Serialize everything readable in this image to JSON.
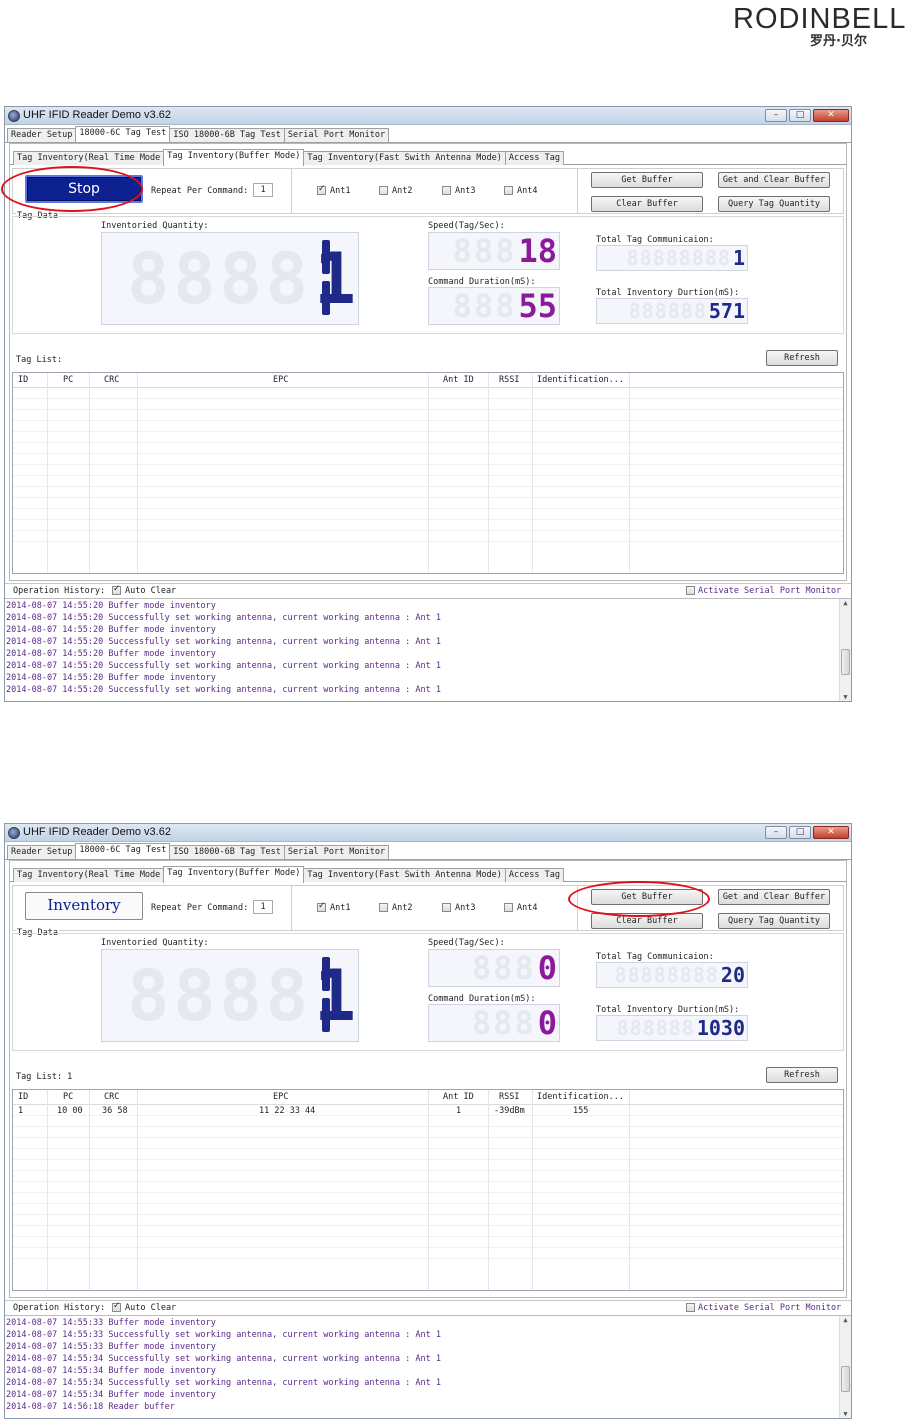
{
  "logo": {
    "main": "RODINBELL",
    "sub": "罗丹·贝尔"
  },
  "common": {
    "window_title": "UHF IFID Reader Demo v3.62",
    "window_buttons": {
      "minimize": "–",
      "maximize": "□",
      "close": "✕"
    },
    "main_tabs": [
      "Reader Setup",
      "18000-6C Tag Test",
      "ISO 18000-6B Tag Test",
      "Serial Port Monitor"
    ],
    "sub_tabs": [
      "Tag Inventory(Real Time Mode",
      "Tag Inventory(Buffer Mode)",
      "Tag Inventory(Fast Swith Antenna Mode)",
      "Access Tag"
    ],
    "repeat_label": "Repeat Per Command:",
    "repeat_value": "1",
    "antennas": [
      "Ant1",
      "Ant2",
      "Ant3",
      "Ant4"
    ],
    "buttons": {
      "get_buffer": "Get Buffer",
      "get_clear_buffer": "Get and Clear Buffer",
      "clear_buffer": "Clear Buffer",
      "query_tag_quantity": "Query Tag Quantity",
      "refresh": "Refresh"
    },
    "tag_data_label": "Tag Data",
    "inventoried_quantity_label": "Inventoried Quantity:",
    "speed_label": "Speed(Tag/Sec):",
    "command_duration_label": "Command Duration(mS):",
    "total_comm_label": "Total Tag Communicaion:",
    "total_duration_label": "Total Inventory Durtion(mS):",
    "columns": [
      "ID",
      "PC",
      "CRC",
      "EPC",
      "Ant ID",
      "RSSI",
      "Identification..."
    ],
    "operation_history_label": "Operation History:",
    "auto_clear_label": "Auto Clear",
    "serial_monitor_label": "Activate Serial Port Monitor"
  },
  "screens": [
    {
      "action_button": "Stop",
      "tag_list_label": "Tag List:",
      "inventoried_quantity": "1",
      "speed": "18",
      "command_duration": "55",
      "total_tag_communication": "1",
      "total_inventory_duration": "571",
      "rows": [],
      "log": [
        "2014-08-07 14:55:20 Buffer mode inventory",
        "2014-08-07 14:55:20 Successfully set working antenna, current working antenna : Ant 1",
        "2014-08-07 14:55:20 Buffer mode inventory",
        "2014-08-07 14:55:20 Successfully set working antenna, current working antenna : Ant 1",
        "2014-08-07 14:55:20 Buffer mode inventory",
        "2014-08-07 14:55:20 Successfully set working antenna, current working antenna : Ant 1",
        "2014-08-07 14:55:20 Buffer mode inventory",
        "2014-08-07 14:55:20 Successfully set working antenna, current working antenna : Ant 1"
      ]
    },
    {
      "action_button": "Inventory",
      "tag_list_label": "Tag List: 1",
      "inventoried_quantity": "1",
      "speed": "0",
      "command_duration": "0",
      "total_tag_communication": "20",
      "total_inventory_duration": "1030",
      "rows": [
        {
          "id": "1",
          "pc": "10 00",
          "crc": "36 58",
          "epc": "11 22 33 44",
          "ant": "1",
          "rssi": "-39dBm",
          "ident": "155"
        }
      ],
      "log": [
        "2014-08-07 14:55:33 Buffer mode inventory",
        "2014-08-07 14:55:33 Successfully set working antenna, current working antenna : Ant 1",
        "2014-08-07 14:55:33 Buffer mode inventory",
        "2014-08-07 14:55:34 Successfully set working antenna, current working antenna : Ant 1",
        "2014-08-07 14:55:34 Buffer mode inventory",
        "2014-08-07 14:55:34 Successfully set working antenna, current working antenna : Ant 1",
        "2014-08-07 14:55:34 Buffer mode inventory",
        "2014-08-07 14:56:18 Reader buffer"
      ]
    }
  ]
}
